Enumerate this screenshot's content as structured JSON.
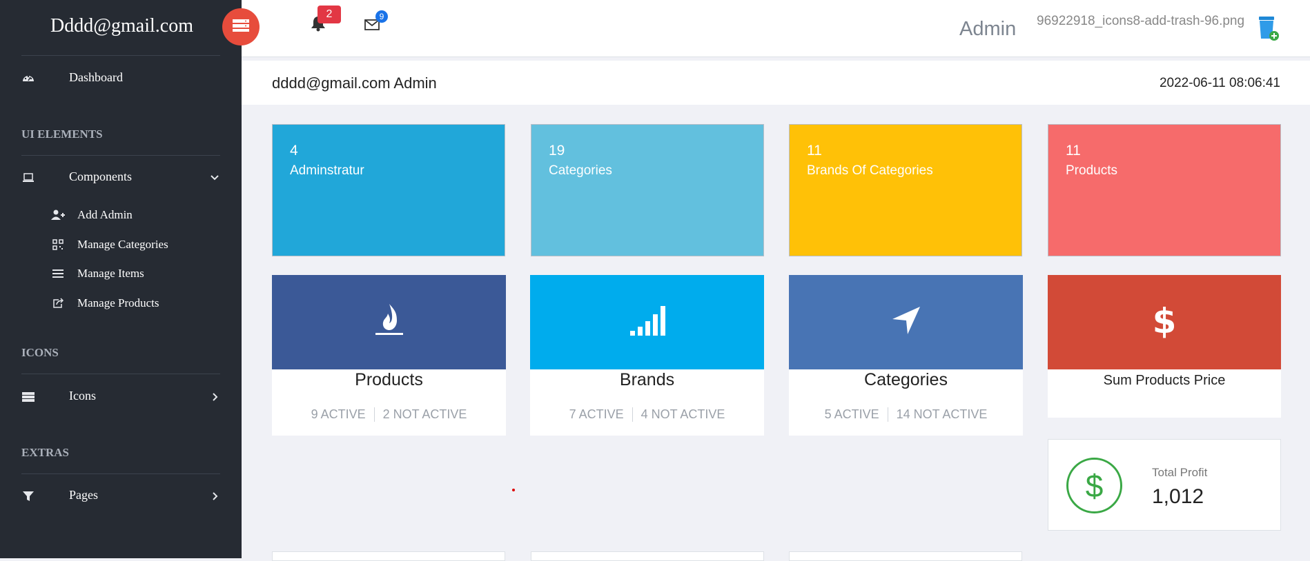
{
  "sidebar": {
    "brand": "Dddd@gmail.com",
    "dashboard": "Dashboard",
    "sections": {
      "ui": "UI ELEMENTS",
      "icons": "ICONS",
      "extras": "EXTRAS"
    },
    "components": "Components",
    "sub_items": [
      "Add Admin",
      "Manage Categories",
      "Manage Items",
      "Manage Products"
    ],
    "icons_item": "Icons",
    "pages_item": "Pages"
  },
  "topbar": {
    "notifications_count": "2",
    "messages_count": "9",
    "admin_name": "Admin",
    "image_name": "96922918_icons8-add-trash-96.png"
  },
  "subheader": {
    "user_label": "dddd@gmail.com Admin",
    "timestamp": "2022-06-11 08:06:41"
  },
  "stats": [
    {
      "number": "4",
      "label": "Adminstratur",
      "color": "#21a7d9"
    },
    {
      "number": "19",
      "label": "Categories",
      "color": "#62c0de"
    },
    {
      "number": "11",
      "label": "Brands Of Categories",
      "color": "#ffc107"
    },
    {
      "number": "11",
      "label": "Products",
      "color": "#f66b6b"
    }
  ],
  "cards": [
    {
      "title": "Products",
      "active": "9 ACTIVE",
      "inactive": "2 NOT ACTIVE",
      "color": "#3b5997",
      "icon": "fire-icon"
    },
    {
      "title": "Brands",
      "active": "7 ACTIVE",
      "inactive": "4 NOT ACTIVE",
      "color": "#00aced",
      "icon": "signal-icon"
    },
    {
      "title": "Categories",
      "active": "5 ACTIVE",
      "inactive": "14 NOT ACTIVE",
      "color": "#4874b4",
      "icon": "location-arrow-icon"
    }
  ],
  "sum_card": {
    "title": "Sum Products Price",
    "color": "#d24a37",
    "icon": "dollar-icon"
  },
  "profit": {
    "label": "Total Profit",
    "value": "1,012",
    "icon": "dollar-circle-icon"
  }
}
